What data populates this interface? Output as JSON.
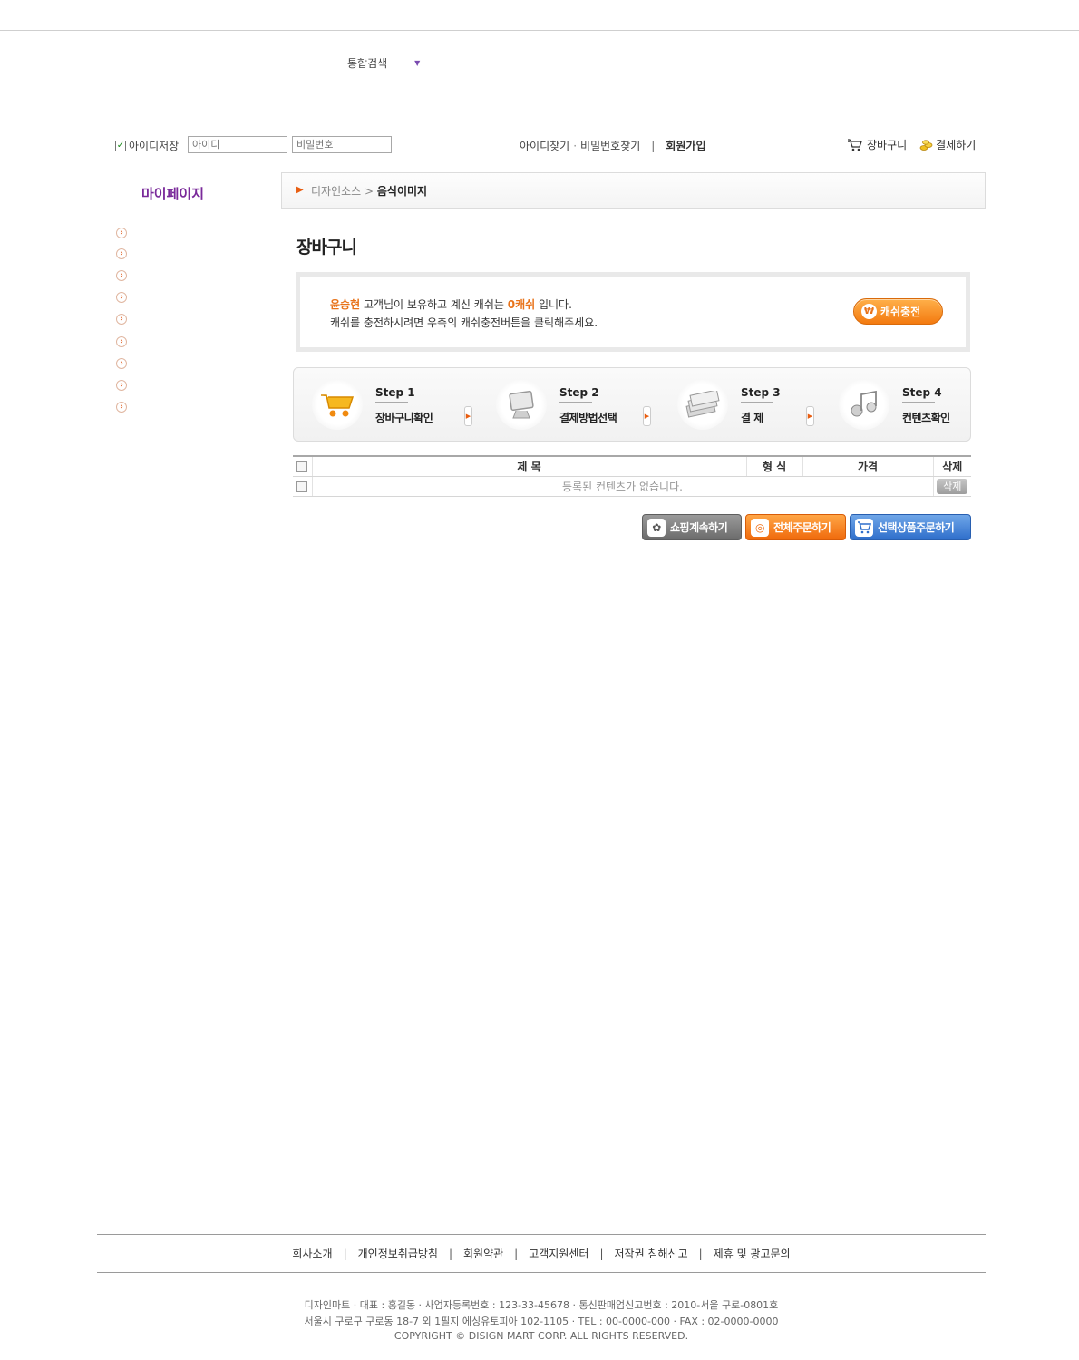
{
  "header": {
    "search_scope": "통합검색"
  },
  "login": {
    "save_id_label": "아이디저장",
    "save_id_checked": true,
    "id_placeholder": "아이디",
    "pw_placeholder": "비밀번호",
    "find_id": "아이디찾기",
    "find_pw": "비밀번호찾기",
    "join": "회원가입"
  },
  "util": {
    "cart": "장바구니",
    "payment": "결제하기"
  },
  "sidebar": {
    "title": "마이페이지",
    "item_count_bullets": 9
  },
  "breadcrumb": {
    "parent": "디자인소스",
    "current": "음식이미지"
  },
  "page": {
    "title": "장바구니"
  },
  "cash": {
    "user": "윤승현",
    "text1_mid": " 고객님이 보유하고 계신 캐쉬는 ",
    "amount": "0캐쉬",
    "text1_end": " 입니다.",
    "text2": "캐쉬를 충전하시려면 우측의 캐쉬충전버튼을 클릭해주세요.",
    "charge_button": "캐쉬충전",
    "won_symbol": "₩"
  },
  "steps": [
    {
      "num": "Step 1",
      "name": "장바구니확인",
      "icon": "cart-icon"
    },
    {
      "num": "Step 2",
      "name": "결제방법선택",
      "icon": "monitor-icon"
    },
    {
      "num": "Step 3",
      "name": "결 제",
      "icon": "money-icon"
    },
    {
      "num": "Step 4",
      "name": "컨텐츠확인",
      "icon": "music-icon"
    }
  ],
  "table": {
    "headers": [
      "제 목",
      "형 식",
      "가격",
      "삭제"
    ],
    "empty_message": "등록된 컨텐츠가 없습니다.",
    "delete_label": "삭제"
  },
  "actions": {
    "continue": "쇼핑계속하기",
    "order_all": "전체주문하기",
    "order_selected": "선택상품주문하기"
  },
  "footer": {
    "links": [
      "회사소개",
      "개인정보취급방침",
      "회원약관",
      "고객지원센터",
      "저작권 침해신고",
      "제휴 및 광고문의"
    ],
    "info1": "디자인마트 · 대표 : 홍길동 · 사업자등록번호 : 123-33-45678 · 통신판매업신고번호 : 2010-서울 구로-0801호",
    "info2": "서울시 구로구 구로동 18-7 외 1필지 에싱유토피아 102-1105 · TEL : 00-0000-000 · FAX : 02-0000-0000",
    "info3": "COPYRIGHT © DISIGN MART CORP. ALL RIGHTS RESERVED."
  }
}
